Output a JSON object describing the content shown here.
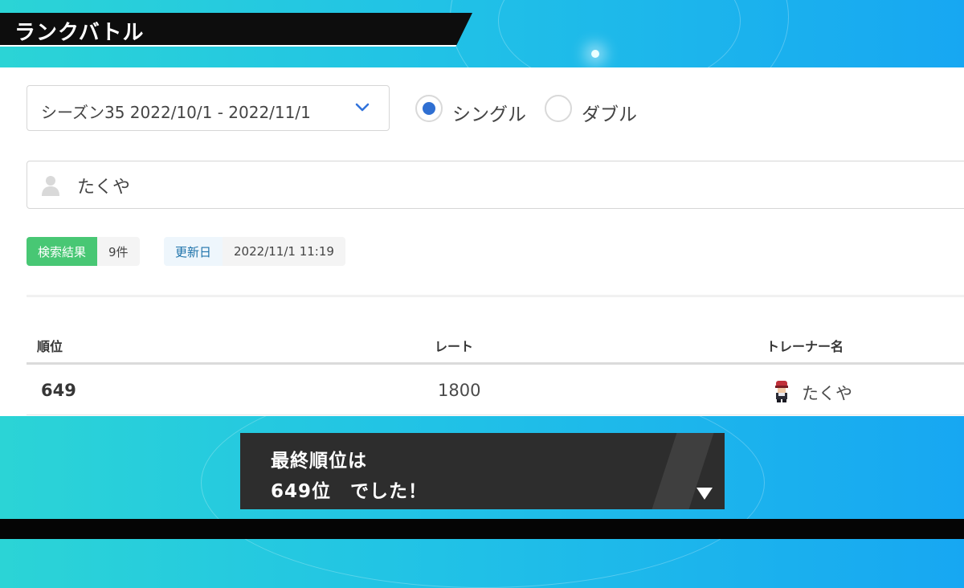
{
  "app": {
    "title": "ランクバトル"
  },
  "filters": {
    "season_value": "シーズン35  2022/10/1 - 2022/11/1",
    "battle_format": {
      "options": [
        "シングル",
        "ダブル"
      ],
      "selected": "シングル"
    },
    "trainer_name_value": "たくや"
  },
  "search_info": {
    "result_label": "検索結果",
    "result_count": "9件",
    "updated_label": "更新日",
    "updated_value": "2022/11/1 11:19"
  },
  "table": {
    "columns": [
      "順位",
      "レート",
      "トレーナー名"
    ],
    "rows": [
      {
        "rank": "649",
        "rate": "1800",
        "trainer": "たくや"
      }
    ]
  },
  "dialog": {
    "line1": "最終順位は",
    "line2": "649位　でした！"
  },
  "icons": {
    "season_dropdown": "chevron-down-icon",
    "name_field": "user-icon",
    "trainer_avatar": "trainer-avatar-icon",
    "dialog_next": "triangle-down-icon"
  },
  "colors": {
    "background_start": "#2bd4d6",
    "background_end": "#17a7f2",
    "accent_blue": "#2f6fd2",
    "result_tag": "#48c774",
    "title_bar": "#0d0d0d",
    "dialog": "#2d2d2d"
  }
}
